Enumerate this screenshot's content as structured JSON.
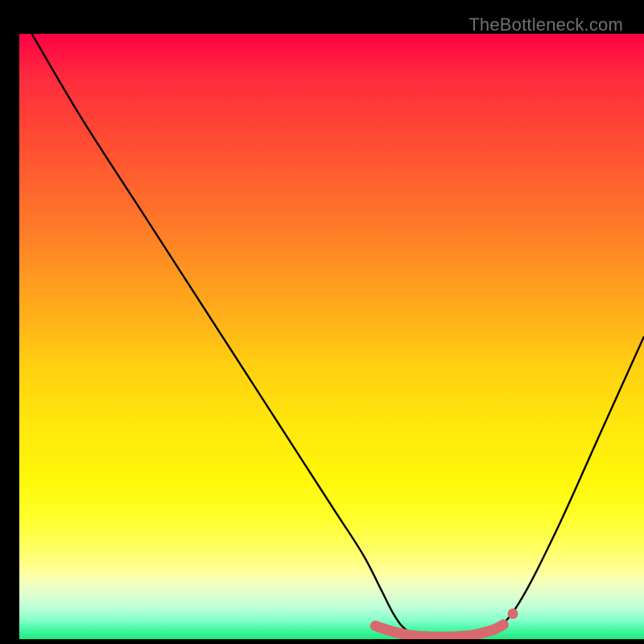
{
  "watermark": "TheBottleneck.com",
  "chart_data": {
    "type": "line",
    "title": "",
    "xlabel": "",
    "ylabel": "",
    "xlim": [
      0,
      100
    ],
    "ylim": [
      0,
      100
    ],
    "grid": false,
    "legend": false,
    "series": [
      {
        "name": "main-curve",
        "color": "#000000",
        "x": [
          2,
          10,
          20,
          30,
          40,
          50,
          55,
          58,
          60,
          62,
          65,
          68,
          70,
          72,
          74,
          76,
          80,
          86,
          93,
          100
        ],
        "y": [
          100,
          86,
          70,
          54,
          38,
          22,
          14,
          8,
          4,
          1.5,
          0.5,
          0.2,
          0.2,
          0.3,
          0.6,
          1.2,
          6,
          18,
          34,
          50
        ]
      },
      {
        "name": "flat-segment-marker",
        "color": "#d86a6e",
        "x": [
          57,
          60,
          63,
          66,
          69,
          72,
          74,
          76,
          77.5
        ],
        "y": [
          2.2,
          1.2,
          0.6,
          0.4,
          0.4,
          0.6,
          1.0,
          1.6,
          2.4
        ]
      },
      {
        "name": "segment-end-dot",
        "color": "#d86a6e",
        "x": [
          79
        ],
        "y": [
          4.2
        ]
      }
    ]
  }
}
